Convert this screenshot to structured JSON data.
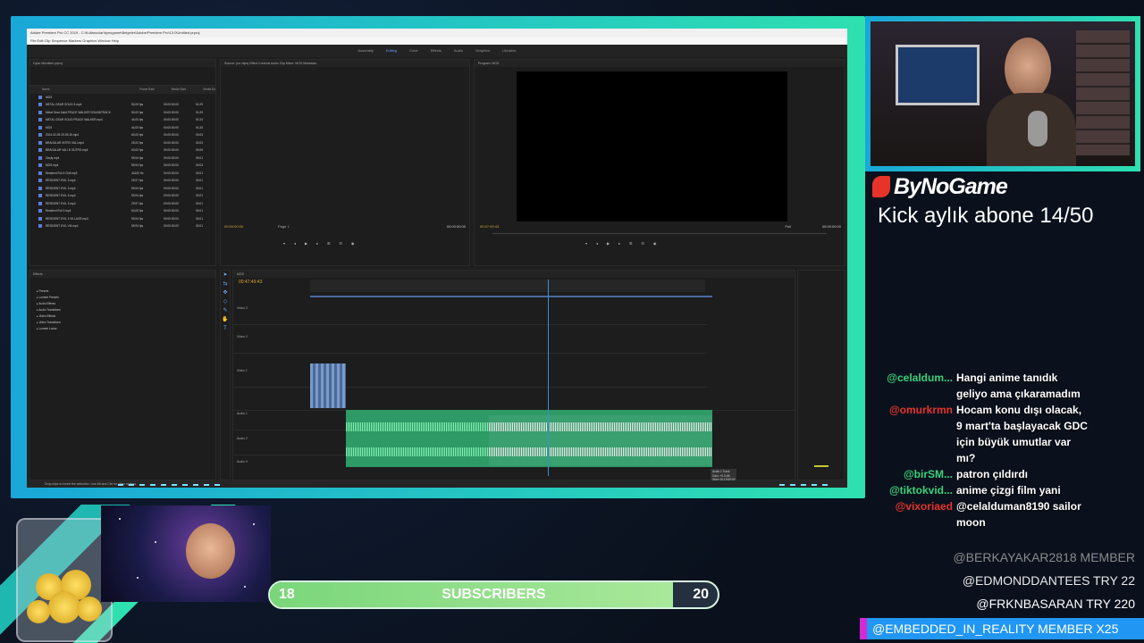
{
  "premiere": {
    "title": "Adobe Premiere Pro CC 2019 - C:\\Kullanıcılar\\bynogame\\Belgeler\\Adobe\\Premiere Pro\\13.0\\Untitled.prproj",
    "menu": "File  Edit  Clip  Sequence  Markers  Graphics  Window  Help",
    "workspaces": [
      "Assembly",
      "Editing",
      "Color",
      "Effects",
      "Audio",
      "Graphics",
      "Libraries"
    ],
    "active_workspace": "Editing",
    "project_tab": "Oyun Müzikleri.prproj",
    "source_tabs": "Source: (no clips)   Effect Controls   Audio Clip Mixer: MGS   Metadata",
    "program_tab": "Program: MGS",
    "files": [
      {
        "name": "MGS",
        "rate": "",
        "start": "",
        "dur": ""
      },
      {
        "name": "METAL GEAR SOLID 3.mp4",
        "rate": "50,00 fps",
        "start": "00:00:00:00",
        "dur": "01:29"
      },
      {
        "name": "Metal Gear Solid PEACE WALKER SOUNDTRACK",
        "rate": "50,00 fps",
        "start": "00:00:00:00",
        "dur": "01:25"
      },
      {
        "name": "METAL GEAR SOLID PEACE WALKER.mp4",
        "rate": "44,00 fps",
        "start": "00:00:00:00",
        "dur": "01:24"
      },
      {
        "name": "MGS",
        "rate": "44,00 fps",
        "start": "00:00:00:00",
        "dur": "01:26"
      },
      {
        "name": "2024-02-05 20-39-15.mp4",
        "rate": "60,00 fps",
        "start": "00:00:00:00",
        "dur": "00:03"
      },
      {
        "name": "BRAGALAR INTRO VALI.mp4",
        "rate": "25,00 fps",
        "start": "00:00:00:00",
        "dur": "00:03"
      },
      {
        "name": "BRAGALAR VALI B OUTRO.mp4",
        "rate": "60,00 fps",
        "start": "00:00:00:00",
        "dur": "00:06"
      },
      {
        "name": "Geçiş.mp4",
        "rate": "59,94 fps",
        "start": "00:00:00:00",
        "dur": "00:01"
      },
      {
        "name": "MGS.mp4",
        "rate": "59,94 fps",
        "start": "00:00:00:00",
        "dur": "00:03"
      },
      {
        "name": "Resident Evil 4 Chill.mp3",
        "rate": "44100 Hz",
        "start": "00:00:00:00",
        "dur": "00:01"
      },
      {
        "name": "RESIDENT EVIL 3.mp4",
        "rate": "29,97 fps",
        "start": "00:00:00:00",
        "dur": "00:01"
      },
      {
        "name": "RESIDENT EVIL 3.mp4",
        "rate": "59,94 fps",
        "start": "00:00:00:00",
        "dur": "00:01"
      },
      {
        "name": "RESIDENT EVIL 3.mp4",
        "rate": "59,94 fps",
        "start": "00:00:00:00",
        "dur": "00:01"
      },
      {
        "name": "RESIDENT EVIL 3.mp4",
        "rate": "29,97 fps",
        "start": "00:00:00:00",
        "dur": "00:01"
      },
      {
        "name": "Resident Evil 3.mp4",
        "rate": "60,00 fps",
        "start": "00:00:00:00",
        "dur": "00:01"
      },
      {
        "name": "RESIDENT EVIL 3 VILLAGE.mp4",
        "rate": "59,94 fps",
        "start": "00:00:00:00",
        "dur": "00:01"
      },
      {
        "name": "RESIDENT EVIL VIII.mp4",
        "rate": "59,94 fps",
        "start": "00:00:00:00",
        "dur": "00:01"
      }
    ],
    "effects_tab": "Effects",
    "effects_tree": [
      "Presets",
      "Lumetri Presets",
      "Audio Effects",
      "Audio Transitions",
      "Video Effects",
      "Video Transitions",
      "Lumetri Looks"
    ],
    "source_tc_left": "00:00:00:00",
    "source_tc_right": "00:00:00:00",
    "page_label": "Page 1",
    "program_tc_left": "00:47:49:43",
    "program_tc_right": "00:00:00:00",
    "fit_label": "Full",
    "seq_tab": "MGS",
    "seq_timecode": "00:47:49:43",
    "tracks": [
      "Video 3",
      "Video 2",
      "Video 1",
      "Audio 1",
      "Audio 2",
      "Audio 3"
    ],
    "status_text": "Drop clips to insert the selection. Use Alt and Ctrl for other options.",
    "tooltip": "Audio 1 Track\nGain: +0.0 dB\nStart: 00:19:59:09\nEnd: 01:20:04:07"
  },
  "overlay": {
    "brand": "ByNoGame",
    "kick_text": "Kick aylık abone 14/50",
    "subs_current": "18",
    "subs_label": "SUBSCRIBERS",
    "subs_goal": "20",
    "subs_progress": 0.9
  },
  "chat": [
    {
      "user": "@celaldum...",
      "color": "#3bd17a",
      "text": "Hangi anime tanıdık geliyo ama çıkaramadım"
    },
    {
      "user": "@omurkrmn",
      "color": "#e8332b",
      "text": "Hocam konu dışı olacak, 9 mart'ta başlayacak GDC için büyük umutlar var mı?"
    },
    {
      "user": "@birSM...",
      "color": "#3bd17a",
      "text": "patron çıldırdı"
    },
    {
      "user": "@tiktokvid...",
      "color": "#3bd17a",
      "text": "anime çizgi film yani"
    },
    {
      "user": "@vixoriaed",
      "color": "#e8332b",
      "text": "@celalduman8190 sailor moon"
    }
  ],
  "members": [
    {
      "text": "@BERKAYAKAR2818  MEMBER",
      "color": "#8a8a8a"
    },
    {
      "text": "@EDMONDDANTEES  TRY 22",
      "color": "#e8e8e8"
    },
    {
      "text": "@FRKNBASARAN  TRY 220",
      "color": "#ffffff"
    }
  ],
  "member_banner": "@EMBEDDED_IN_REALITY  MEMBER X25",
  "colors": {
    "accent_cyan": "#19a7d8",
    "accent_green": "#2ee0b0",
    "audio_clip": "#2e9a66",
    "timecode": "#d9a83a",
    "kick_red": "#e8332b",
    "member_blue": "#2196f3"
  }
}
